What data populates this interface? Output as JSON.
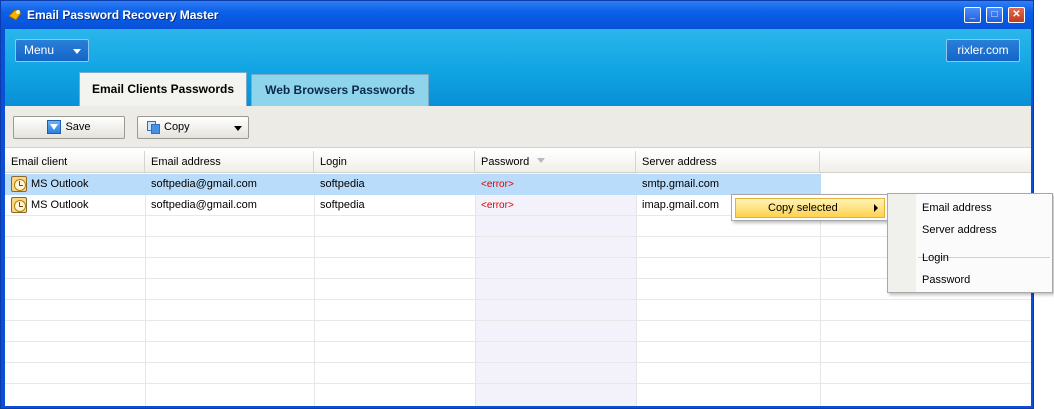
{
  "window": {
    "title": "Email Password Recovery Master",
    "controls": [
      "_",
      "□",
      "✕"
    ]
  },
  "banner": {
    "menu_label": "Menu",
    "site_label": "rixler.com"
  },
  "tabs": [
    {
      "label": "Email Clients Passwords",
      "active": true
    },
    {
      "label": "Web Browsers Passwords",
      "active": false
    }
  ],
  "toolbar": {
    "save_label": "Save",
    "copy_label": "Copy"
  },
  "grid": {
    "columns": [
      "Email client",
      "Email address",
      "Login",
      "Password",
      "Server address"
    ],
    "sorted_column": "Password",
    "rows": [
      {
        "client": "MS Outlook",
        "email": "softpedia@gmail.com",
        "login": "softpedia",
        "password": "<error>",
        "server": "smtp.gmail.com",
        "selected": true
      },
      {
        "client": "MS Outlook",
        "email": "softpedia@gmail.com",
        "login": "softpedia",
        "password": "<error>",
        "server": "imap.gmail.com",
        "selected": false
      }
    ]
  },
  "context_menu": {
    "item": "Copy selected",
    "submenu": [
      "Email address",
      "Server address",
      "Login",
      "Password"
    ]
  },
  "colors": {
    "title_bar": "#0a5fe8",
    "banner": "#10a4e3",
    "selection": "#b9dcfb",
    "error_text": "#e00000",
    "menu_highlight": "#ffd24d"
  }
}
